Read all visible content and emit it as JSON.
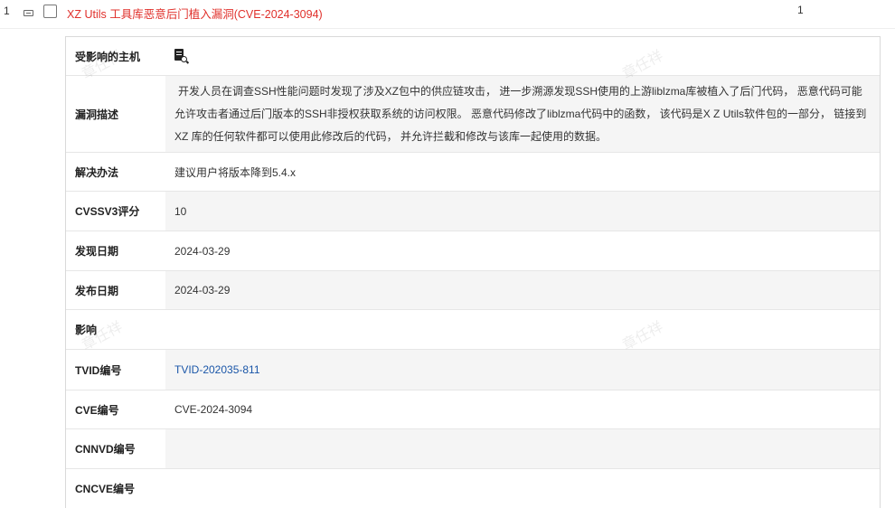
{
  "row": {
    "index": "1",
    "title": "XZ Utils 工具库恶意后门植入漏洞(CVE-2024-3094)",
    "count": "1"
  },
  "details": {
    "affected_host_label": "受影响的主机",
    "description_label": "漏洞描述",
    "description_text": "开发人员在调查SSH性能问题时发现了涉及XZ包中的供应链攻击， 进一步溯源发现SSH使用的上游liblzma库被植入了后门代码， 恶意代码可能允许攻击者通过后门版本的SSH非授权获取系统的访问权限。 恶意代码修改了liblzma代码中的函数， 该代码是X Z Utils软件包的一部分， 链接到 XZ 库的任何软件都可以使用此修改后的代码， 并允许拦截和修改与该库一起使用的数据。",
    "solution_label": "解决办法",
    "solution_text": "建议用户将版本降到5.4.x",
    "cvss_label": "CVSSV3评分",
    "cvss_value": "10",
    "found_date_label": "发现日期",
    "found_date": "2024-03-29",
    "publish_date_label": "发布日期",
    "publish_date": "2024-03-29",
    "impact_label": "影响",
    "impact_value": "",
    "tvid_label": "TVID编号",
    "tvid_value": "TVID-202035-811",
    "cve_label": "CVE编号",
    "cve_value": "CVE-2024-3094",
    "cnnvd_label": "CNNVD编号",
    "cnnvd_value": "",
    "cncve_label": "CNCVE编号",
    "cncve_value": ""
  },
  "watermark": "章任祥",
  "colors": {
    "title_red": "#e0302b",
    "link_blue": "#1a56a8",
    "shade": "#f5f5f5"
  },
  "icons": {
    "affected_host": "host-search-icon"
  }
}
